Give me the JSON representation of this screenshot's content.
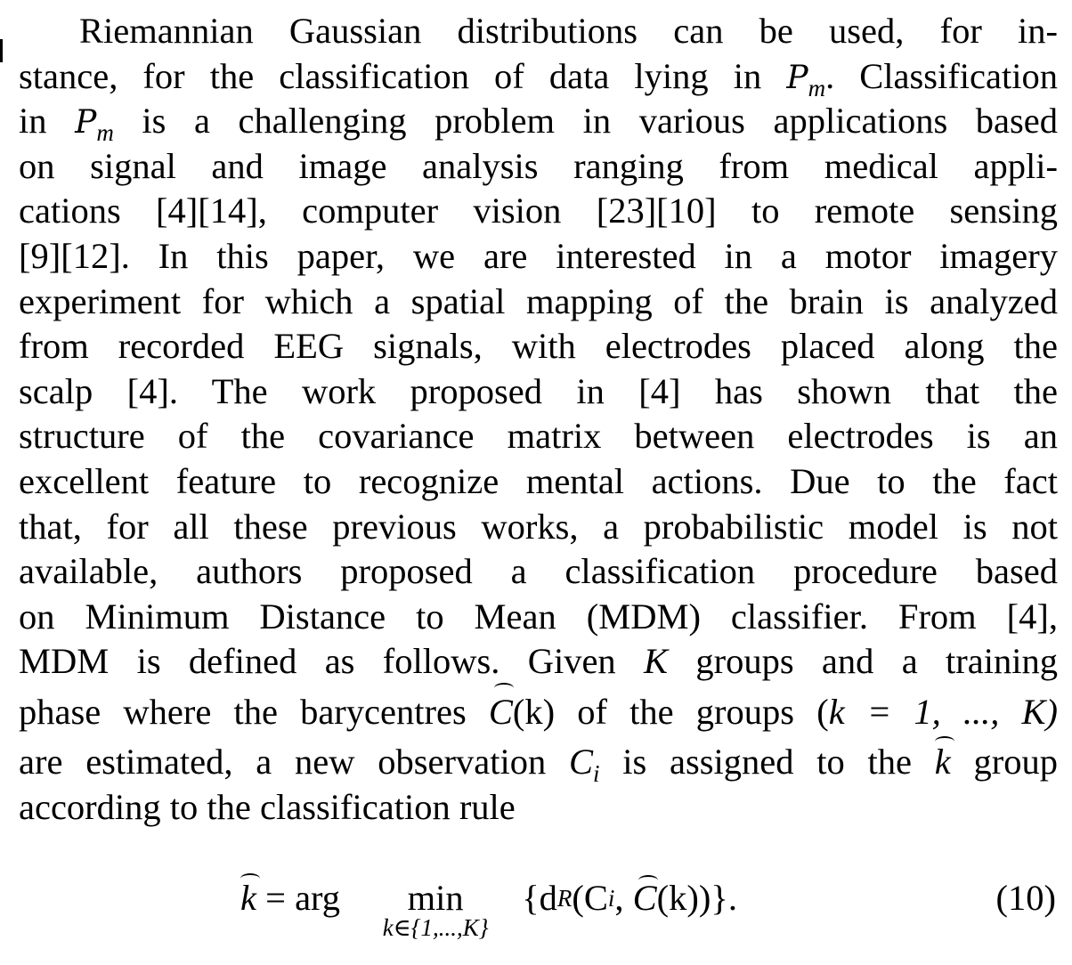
{
  "paragraph": {
    "l1": "Riemannian Gaussian distributions can be used, for in-",
    "l2a": "stance, for the classification of data lying in ",
    "l2b": ". Classification",
    "l3a": "in ",
    "l3b": " is a challenging problem in various applications based",
    "l4": "on signal and image analysis ranging from medical appli-",
    "l5": "cations [4][14], computer vision [23][10] to remote sensing",
    "l6": "[9][12]. In this paper, we are interested in a motor imagery",
    "l7": "experiment for which a spatial mapping of the brain is analyzed",
    "l8": "from recorded EEG signals, with electrodes placed along the",
    "l9": "scalp [4]. The work proposed in [4] has shown that the",
    "l10": "structure of the covariance matrix between electrodes is an",
    "l11": "excellent feature to recognize mental actions. Due to the fact",
    "l12": "that, for all these previous works, a probabilistic model is not",
    "l13": "available, authors proposed a classification procedure based",
    "l14": "on Minimum Distance to Mean (MDM) classifier. From [4],",
    "l15a": "MDM is defined as follows. Given ",
    "l15b": " groups and a training",
    "l16a": "phase where the barycentres ",
    "l16b": "(k) of the groups (",
    "l16c": "k = 1, ..., K)",
    "l17a": "are estimated, a new observation ",
    "l17b": " is assigned to the ",
    "l17c": " group",
    "l18": "according to the classification rule"
  },
  "math": {
    "P": "P",
    "m": "m",
    "K": "K",
    "C": "C",
    "i": "i",
    "k": "k"
  },
  "equation": {
    "lhs": "k",
    "equals_arg": " = arg",
    "min": "min",
    "under": "k∈{1,...,K}",
    "rhs_a": "{d",
    "rhs_sub": "R",
    "rhs_b": "(C",
    "rhs_sub2": "i",
    "rhs_c": ", ",
    "rhs_d": "(k))}.",
    "number": "(10)"
  }
}
